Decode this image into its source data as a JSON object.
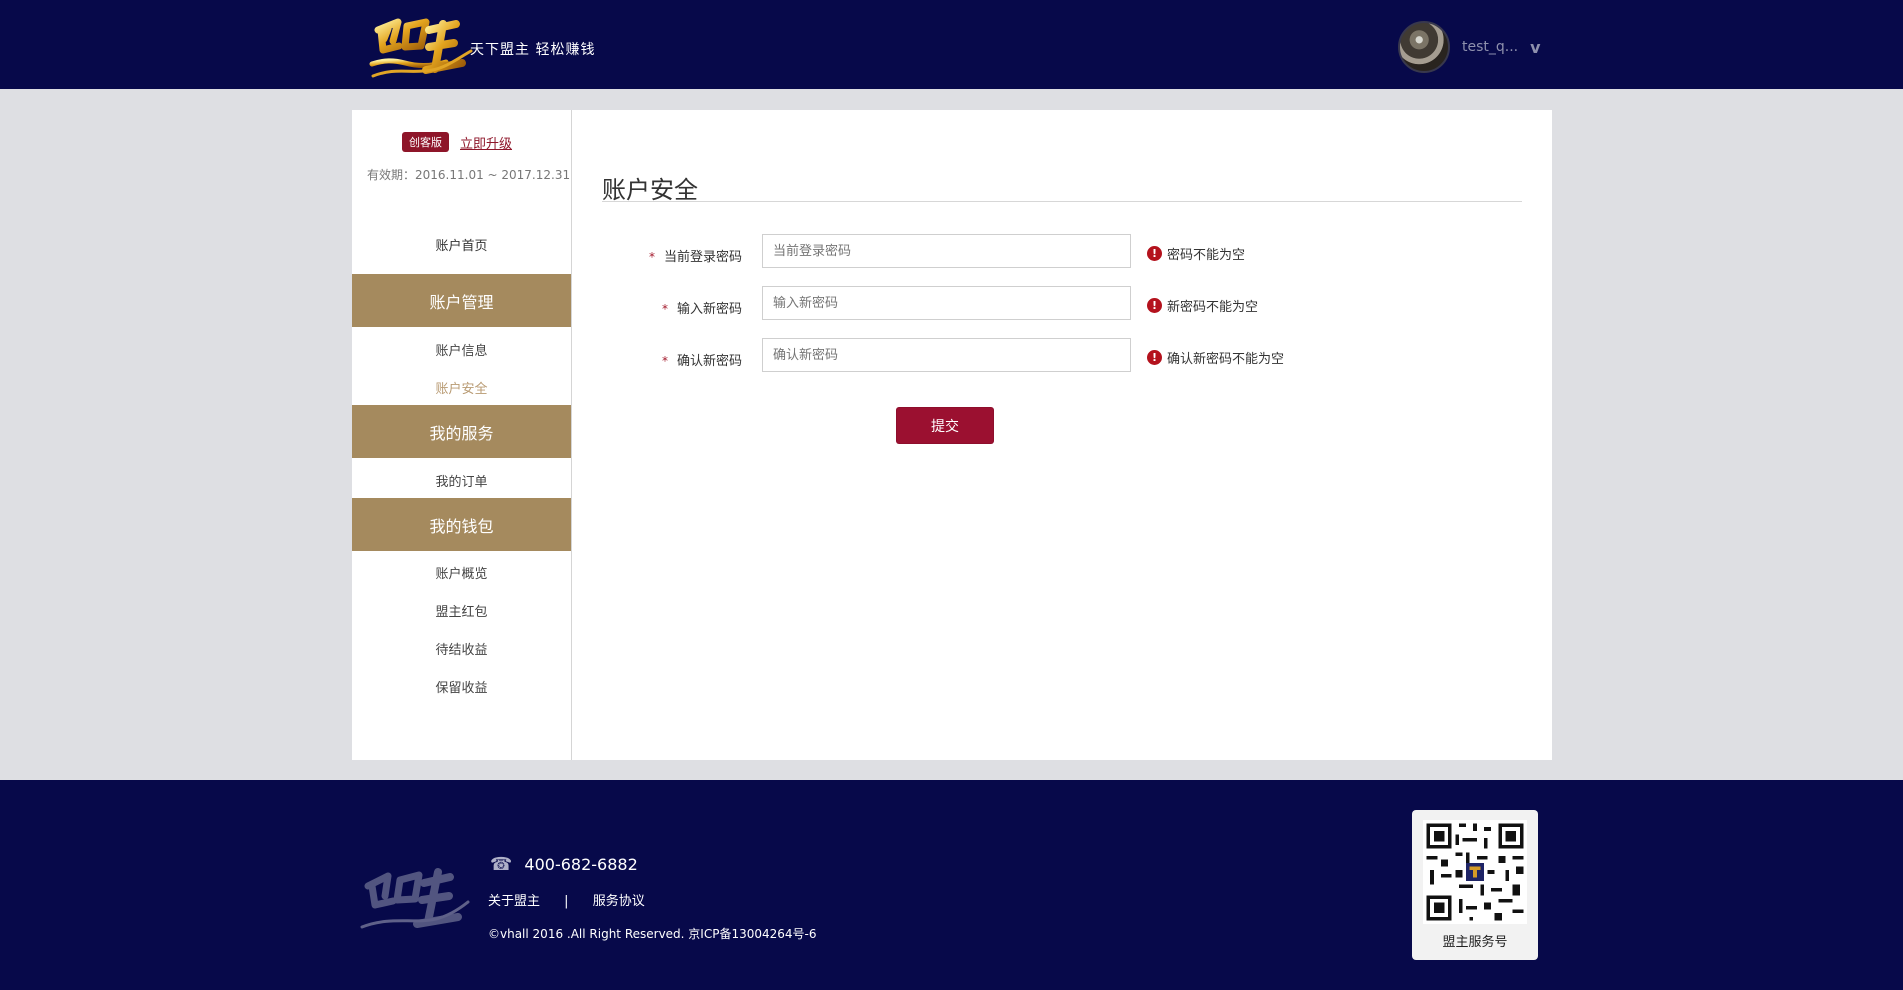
{
  "header": {
    "brand_logo_text": "盟主",
    "slogan": "天下盟主  轻松赚钱",
    "username": "test_q...",
    "user_menu_caret": "v"
  },
  "sidebar": {
    "edition_badge": "创客版",
    "upgrade_link": "立即升级",
    "validity": "有效期：2016.11.01 ~ 2017.12.31",
    "home": "账户首页",
    "sections": [
      {
        "title": "账户管理",
        "items": [
          "账户信息",
          "账户安全"
        ]
      },
      {
        "title": "我的服务",
        "items": [
          "我的订单"
        ]
      },
      {
        "title": "我的钱包",
        "items": [
          "账户概览",
          "盟主红包",
          "待结收益",
          "保留收益"
        ]
      }
    ],
    "active_item": "账户安全"
  },
  "content": {
    "title": "账户安全",
    "form": [
      {
        "label": "当前登录密码",
        "placeholder": "当前登录密码",
        "error": "密码不能为空"
      },
      {
        "label": "输入新密码",
        "placeholder": "输入新密码",
        "error": "新密码不能为空"
      },
      {
        "label": "确认新密码",
        "placeholder": "确认新密码",
        "error": "确认新密码不能为空"
      }
    ],
    "required_mark": "*",
    "error_mark": "!",
    "submit": "提交"
  },
  "footer": {
    "brand_logo_text": "盟主",
    "phone": "400-682-6882",
    "links": [
      "关于盟主",
      "服务协议"
    ],
    "separator": "|",
    "copyright": "©vhall 2016 .All Right Reserved. 京ICP备13004264号-6",
    "qr_label": "盟主服务号"
  },
  "colors": {
    "navy": "#07094a",
    "gold": "#a58a5e",
    "red": "#9b1030",
    "page_bg": "#dedfe3"
  },
  "icons": {
    "phone": "phone-icon",
    "error": "error-icon",
    "qr": "qr-code-icon",
    "logo": "brand-logo"
  }
}
